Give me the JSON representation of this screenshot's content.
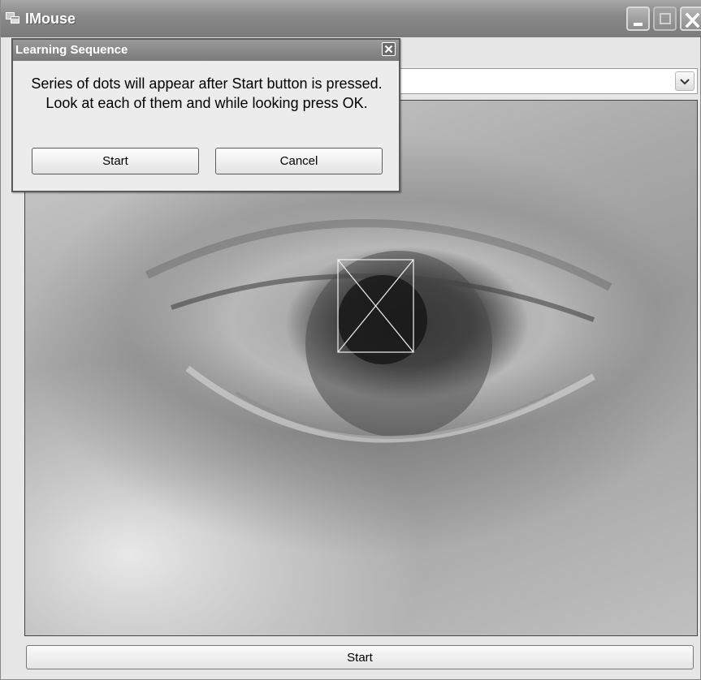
{
  "window": {
    "title": "IMouse",
    "icon": "app-window-icon"
  },
  "titlebar_buttons": [
    "minimize-icon",
    "maximize-icon",
    "close-icon"
  ],
  "camera_select": {
    "value": "",
    "icon": "chevron-down-icon"
  },
  "video": {
    "marker": "tracking-box-icon"
  },
  "bottom": {
    "start_label": "Start"
  },
  "dialog": {
    "title": "Learning Sequence",
    "message": "Series of dots will appear after Start button is pressed. Look at each of them and while looking press OK.",
    "start_label": "Start",
    "cancel_label": "Cancel",
    "close_icon": "close-icon"
  }
}
